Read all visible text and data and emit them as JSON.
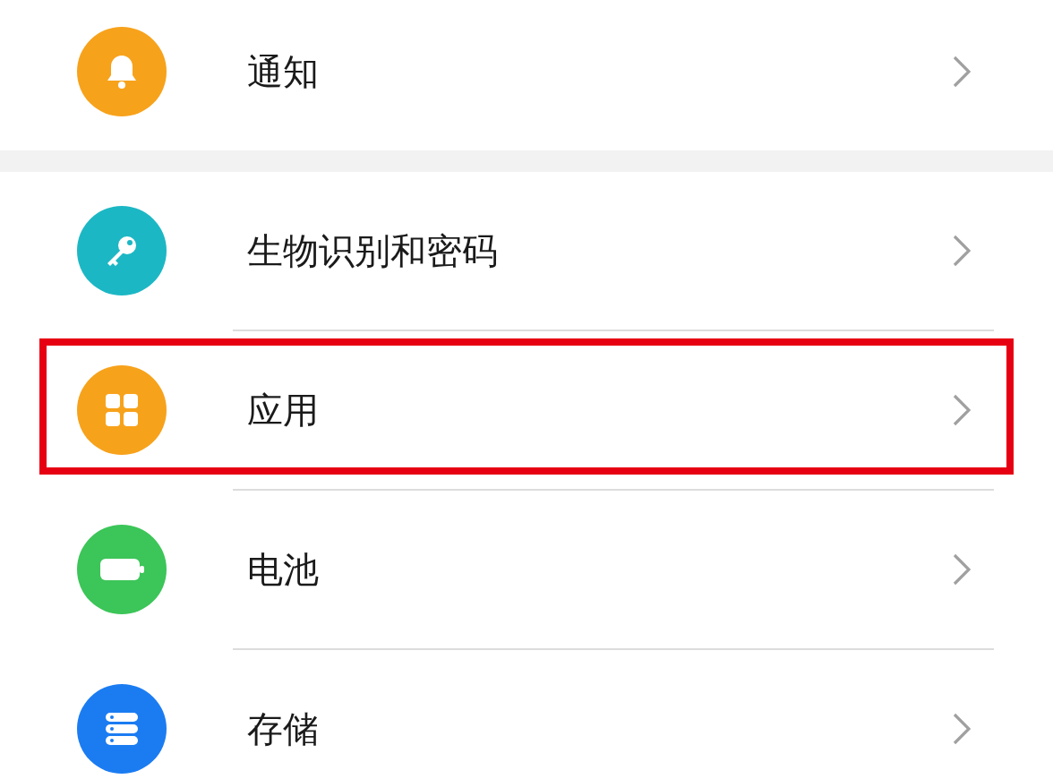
{
  "groups": [
    {
      "items": [
        {
          "label": "通知",
          "kind": "bell",
          "highlighted": false
        }
      ]
    },
    {
      "items": [
        {
          "label": "生物识别和密码",
          "kind": "key",
          "highlighted": false
        },
        {
          "label": "应用",
          "kind": "grid",
          "highlighted": true
        },
        {
          "label": "电池",
          "kind": "battery",
          "highlighted": false
        },
        {
          "label": "存储",
          "kind": "storage",
          "highlighted": false
        }
      ]
    }
  ]
}
